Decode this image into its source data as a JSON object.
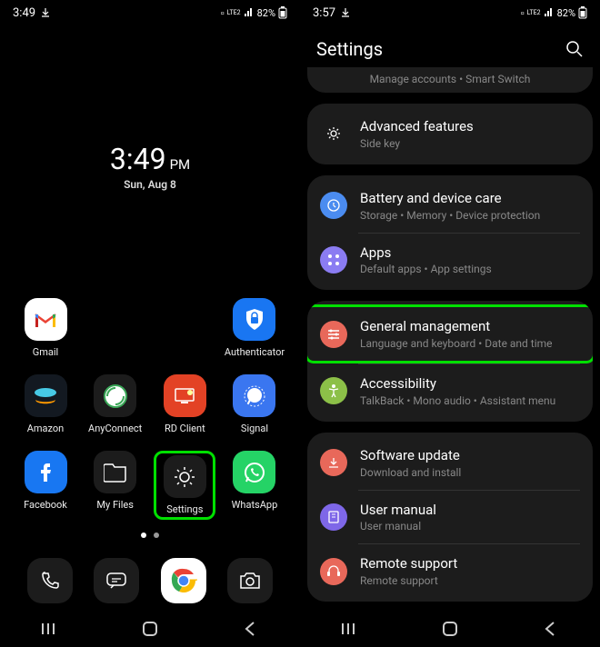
{
  "left": {
    "status_time": "3:49",
    "status_battery": "82%",
    "status_net": "LTE2",
    "clock_time": "3:49",
    "clock_ampm": "PM",
    "clock_date": "Sun, Aug 8",
    "apps": {
      "r1": [
        {
          "label": "Gmail",
          "icon": "gmail"
        },
        {
          "label": "",
          "icon": ""
        },
        {
          "label": "",
          "icon": ""
        },
        {
          "label": "Authenticator",
          "icon": "auth"
        }
      ],
      "r2": [
        {
          "label": "Amazon",
          "icon": "amazon"
        },
        {
          "label": "AnyConnect",
          "icon": "anyconnect"
        },
        {
          "label": "RD Client",
          "icon": "rd"
        },
        {
          "label": "Signal",
          "icon": "signal"
        }
      ],
      "r3": [
        {
          "label": "Facebook",
          "icon": "facebook"
        },
        {
          "label": "My Files",
          "icon": "files"
        },
        {
          "label": "Settings",
          "icon": "settings"
        },
        {
          "label": "WhatsApp",
          "icon": "whatsapp"
        }
      ]
    }
  },
  "right": {
    "status_time": "3:57",
    "status_battery": "82%",
    "status_net": "LTE2",
    "header_title": "Settings",
    "partial_top": "Manage accounts  •  Smart Switch",
    "items": [
      {
        "title": "Advanced features",
        "sub": "Side key",
        "color": "#e8685a"
      },
      {
        "title": "Battery and device care",
        "sub": "Storage  •  Memory  •  Device protection",
        "color": "#4b8cf0"
      },
      {
        "title": "Apps",
        "sub": "Default apps  •  App settings",
        "color": "#8b7cf2"
      },
      {
        "title": "General management",
        "sub": "Language and keyboard  •  Date and time",
        "color": "#e8685a"
      },
      {
        "title": "Accessibility",
        "sub": "TalkBack  •  Mono audio  •  Assistant menu",
        "color": "#8cc048"
      },
      {
        "title": "Software update",
        "sub": "Download and install",
        "color": "#e8685a"
      },
      {
        "title": "User manual",
        "sub": "User manual",
        "color": "#7e67e8"
      },
      {
        "title": "Remote support",
        "sub": "Remote support",
        "color": "#e8685a"
      }
    ]
  }
}
